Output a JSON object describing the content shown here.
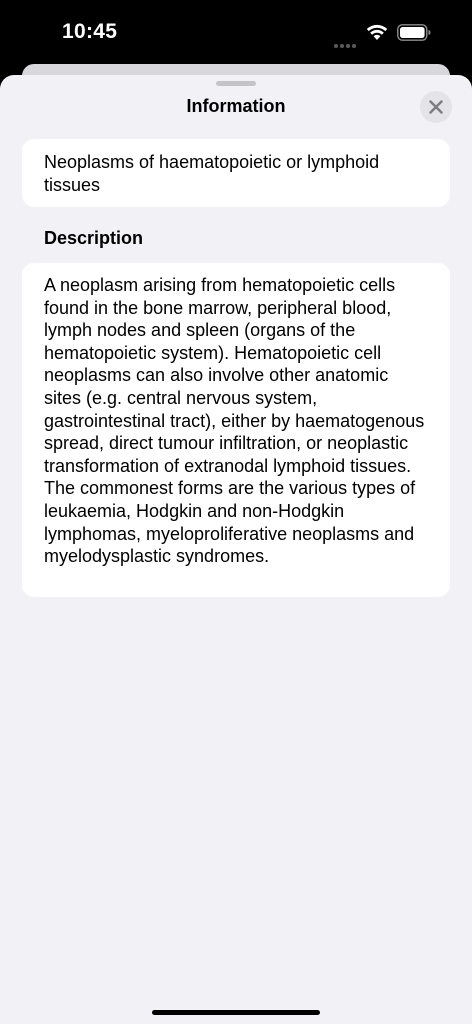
{
  "status_bar": {
    "time": "10:45"
  },
  "sheet": {
    "title": "Information",
    "close_icon": "xmark-icon",
    "term_name": "Neoplasms of haematopoietic or lymphoid tissues",
    "description_header": "Description",
    "description_text": "A neoplasm arising from hematopoietic cells found in the bone marrow, peripheral blood, lymph nodes and spleen (organs of the hematopoietic system). Hematopoietic cell neoplasms can also involve other anatomic sites (e.g. central nervous system, gastrointestinal tract), either by haematogenous spread, direct tumour infiltration, or neoplastic transformation of extranodal lymphoid tissues. The commonest forms are the various types of leukaemia, Hodgkin and non-Hodgkin lymphomas, myeloproliferative neoplasms and myelodysplastic syndromes."
  },
  "colors": {
    "sheet_background": "#f2f1f6",
    "card_background": "#ffffff",
    "status_bar_background": "#000000",
    "close_button_background": "#e3e3e8"
  }
}
